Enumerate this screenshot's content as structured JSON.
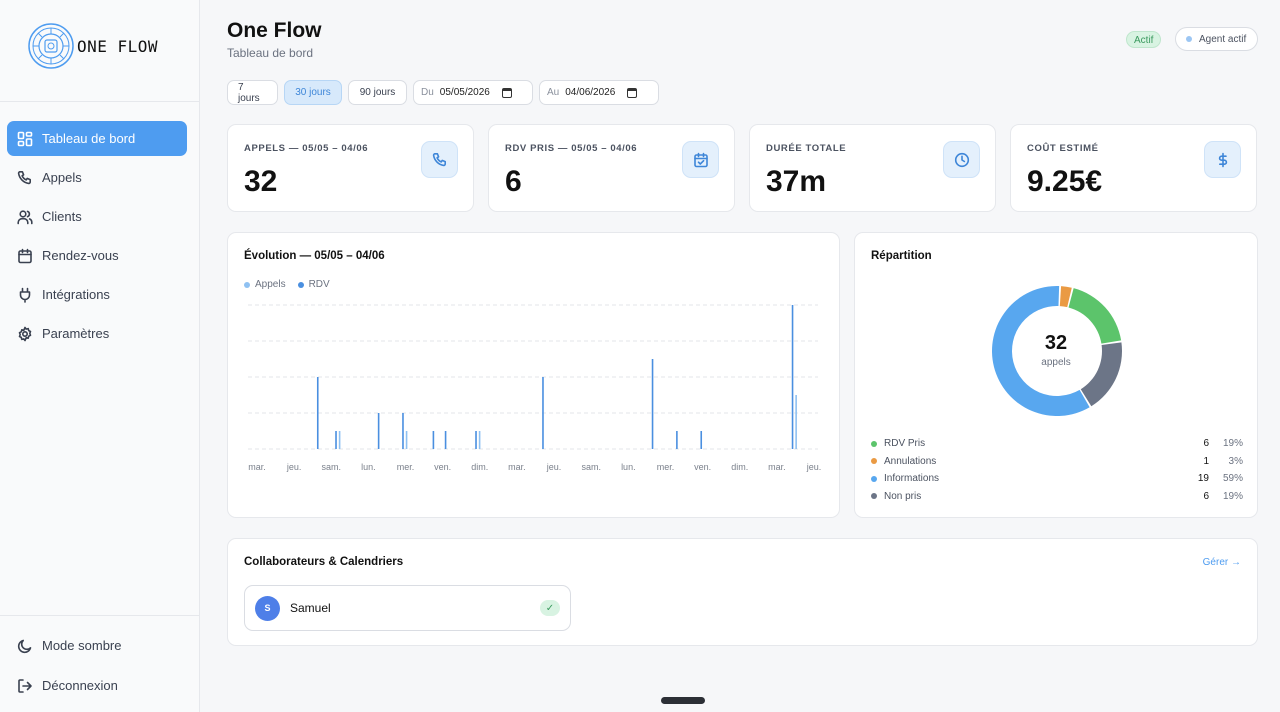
{
  "app": {
    "logo_text": "ONE FLOW"
  },
  "sidebar": {
    "items": [
      {
        "label": "Tableau de bord",
        "icon": "dashboard-icon",
        "active": true
      },
      {
        "label": "Appels",
        "icon": "phone-icon"
      },
      {
        "label": "Clients",
        "icon": "users-icon"
      },
      {
        "label": "Rendez-vous",
        "icon": "calendar-icon"
      },
      {
        "label": "Intégrations",
        "icon": "plug-icon"
      },
      {
        "label": "Paramètres",
        "icon": "gear-icon"
      }
    ],
    "bottom": [
      {
        "label": "Mode sombre",
        "icon": "moon-icon"
      },
      {
        "label": "Déconnexion",
        "icon": "logout-icon"
      }
    ]
  },
  "header": {
    "title": "One Flow",
    "subtitle": "Tableau de bord",
    "status_badge": "Actif",
    "agent_label": "Agent actif"
  },
  "filters": {
    "ranges": [
      "7 jours",
      "30 jours",
      "90 jours"
    ],
    "active_range": "30 jours",
    "from_prefix": "Du",
    "from_value": "05/05/2026",
    "to_prefix": "Au",
    "to_value": "04/06/2026"
  },
  "kpis": [
    {
      "label": "APPELS — 05/05 – 04/06",
      "value": "32",
      "icon": "phone-icon"
    },
    {
      "label": "RDV PRIS — 05/05 – 04/06",
      "value": "6",
      "icon": "calendar-check-icon"
    },
    {
      "label": "DURÉE TOTALE",
      "value": "37m",
      "icon": "clock-icon"
    },
    {
      "label": "COÛT ESTIMÉ",
      "value": "9.25€",
      "icon": "dollar-icon"
    }
  ],
  "evolution": {
    "title": "Évolution — 05/05 – 04/06",
    "legend": [
      {
        "name": "Appels",
        "color": "#8fc1f2"
      },
      {
        "name": "RDV",
        "color": "#4a8fe0"
      }
    ]
  },
  "chart_data": {
    "type": "bar",
    "ylim": [
      0,
      4
    ],
    "grid": true,
    "x_tick_labels": [
      "mar.",
      "jeu.",
      "sam.",
      "lun.",
      "mer.",
      "ven.",
      "dim.",
      "mar.",
      "jeu.",
      "sam.",
      "lun.",
      "mer.",
      "ven.",
      "dim.",
      "mar.",
      "jeu."
    ],
    "series": [
      {
        "name": "Appels",
        "color": "#4a8fe0",
        "values": [
          0,
          0,
          0,
          0,
          0,
          0,
          0,
          0,
          0,
          0,
          0,
          2,
          0,
          0,
          0.5,
          0,
          0,
          0,
          0,
          0,
          0,
          1,
          0,
          0,
          0,
          1,
          0,
          0,
          0,
          0,
          0.5,
          0,
          0.5,
          0,
          0,
          0,
          0,
          0.5,
          0,
          0,
          0,
          0,
          0,
          0,
          0,
          0,
          0,
          0,
          2,
          0,
          0,
          0,
          0,
          0,
          0,
          0,
          0,
          0,
          0,
          0,
          0,
          0,
          0,
          0,
          0,
          0,
          2.5,
          0,
          0,
          0,
          0.5,
          0,
          0,
          0,
          0.5,
          0,
          0,
          0,
          0,
          0,
          0,
          0,
          0,
          0,
          0,
          0,
          0,
          0,
          0,
          4,
          0,
          0,
          0
        ]
      },
      {
        "name": "RDV",
        "color": "#8fc1f2",
        "values": [
          0,
          0,
          0,
          0,
          0,
          0,
          0,
          0,
          0,
          0,
          0,
          0,
          0,
          0,
          0.5,
          0,
          0,
          0,
          0,
          0,
          0,
          0,
          0,
          0,
          0,
          0.5,
          0,
          0,
          0,
          0,
          0,
          0,
          0,
          0,
          0,
          0,
          0,
          0.5,
          0,
          0,
          0,
          0,
          0,
          0,
          0,
          0,
          0,
          0,
          0,
          0,
          0,
          0,
          0,
          0,
          0,
          0,
          0,
          0,
          0,
          0,
          0,
          0,
          0,
          0,
          0,
          0,
          0,
          0,
          0,
          0,
          0,
          0,
          0,
          0,
          0,
          0,
          0,
          0,
          0,
          0,
          0,
          0,
          0,
          0,
          0,
          0,
          0,
          0,
          0,
          1.5,
          0,
          0,
          0
        ]
      }
    ]
  },
  "repartition": {
    "title": "Répartition",
    "center_value": "32",
    "center_label": "appels",
    "chart_data": {
      "type": "pie",
      "slices": [
        {
          "label": "RDV Pris",
          "value": 6,
          "pct": "19%",
          "color": "#5cc46b"
        },
        {
          "label": "Annulations",
          "value": 1,
          "pct": "3%",
          "color": "#ea9a43"
        },
        {
          "label": "Informations",
          "value": 19,
          "pct": "59%",
          "color": "#58a7ef"
        },
        {
          "label": "Non pris",
          "value": 6,
          "pct": "19%",
          "color": "#6c7587"
        }
      ]
    }
  },
  "collaborators": {
    "title": "Collaborateurs & Calendriers",
    "manage_label": "Gérer →",
    "people": [
      {
        "initial": "S",
        "name": "Samuel",
        "check": "✓"
      }
    ]
  }
}
